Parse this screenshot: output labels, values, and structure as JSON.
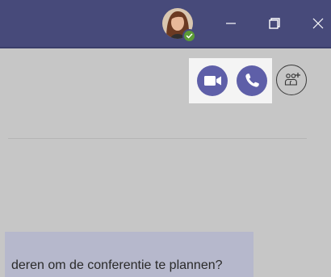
{
  "message": {
    "text": "deren om de conferentie te plannen?"
  },
  "icons": {
    "avatar": "user-avatar",
    "presence": "available-check-icon",
    "minimize": "minimize-icon",
    "maximize": "maximize-icon",
    "close": "close-icon",
    "video": "video-camera-icon",
    "audio": "phone-icon",
    "add_people": "add-people-icon"
  },
  "colors": {
    "titlebar": "#474a7a",
    "call_button": "#5e5fa8",
    "presence_available": "#5b9b35",
    "message_bubble": "#b6b8cc",
    "background": "#c6c6c6"
  }
}
